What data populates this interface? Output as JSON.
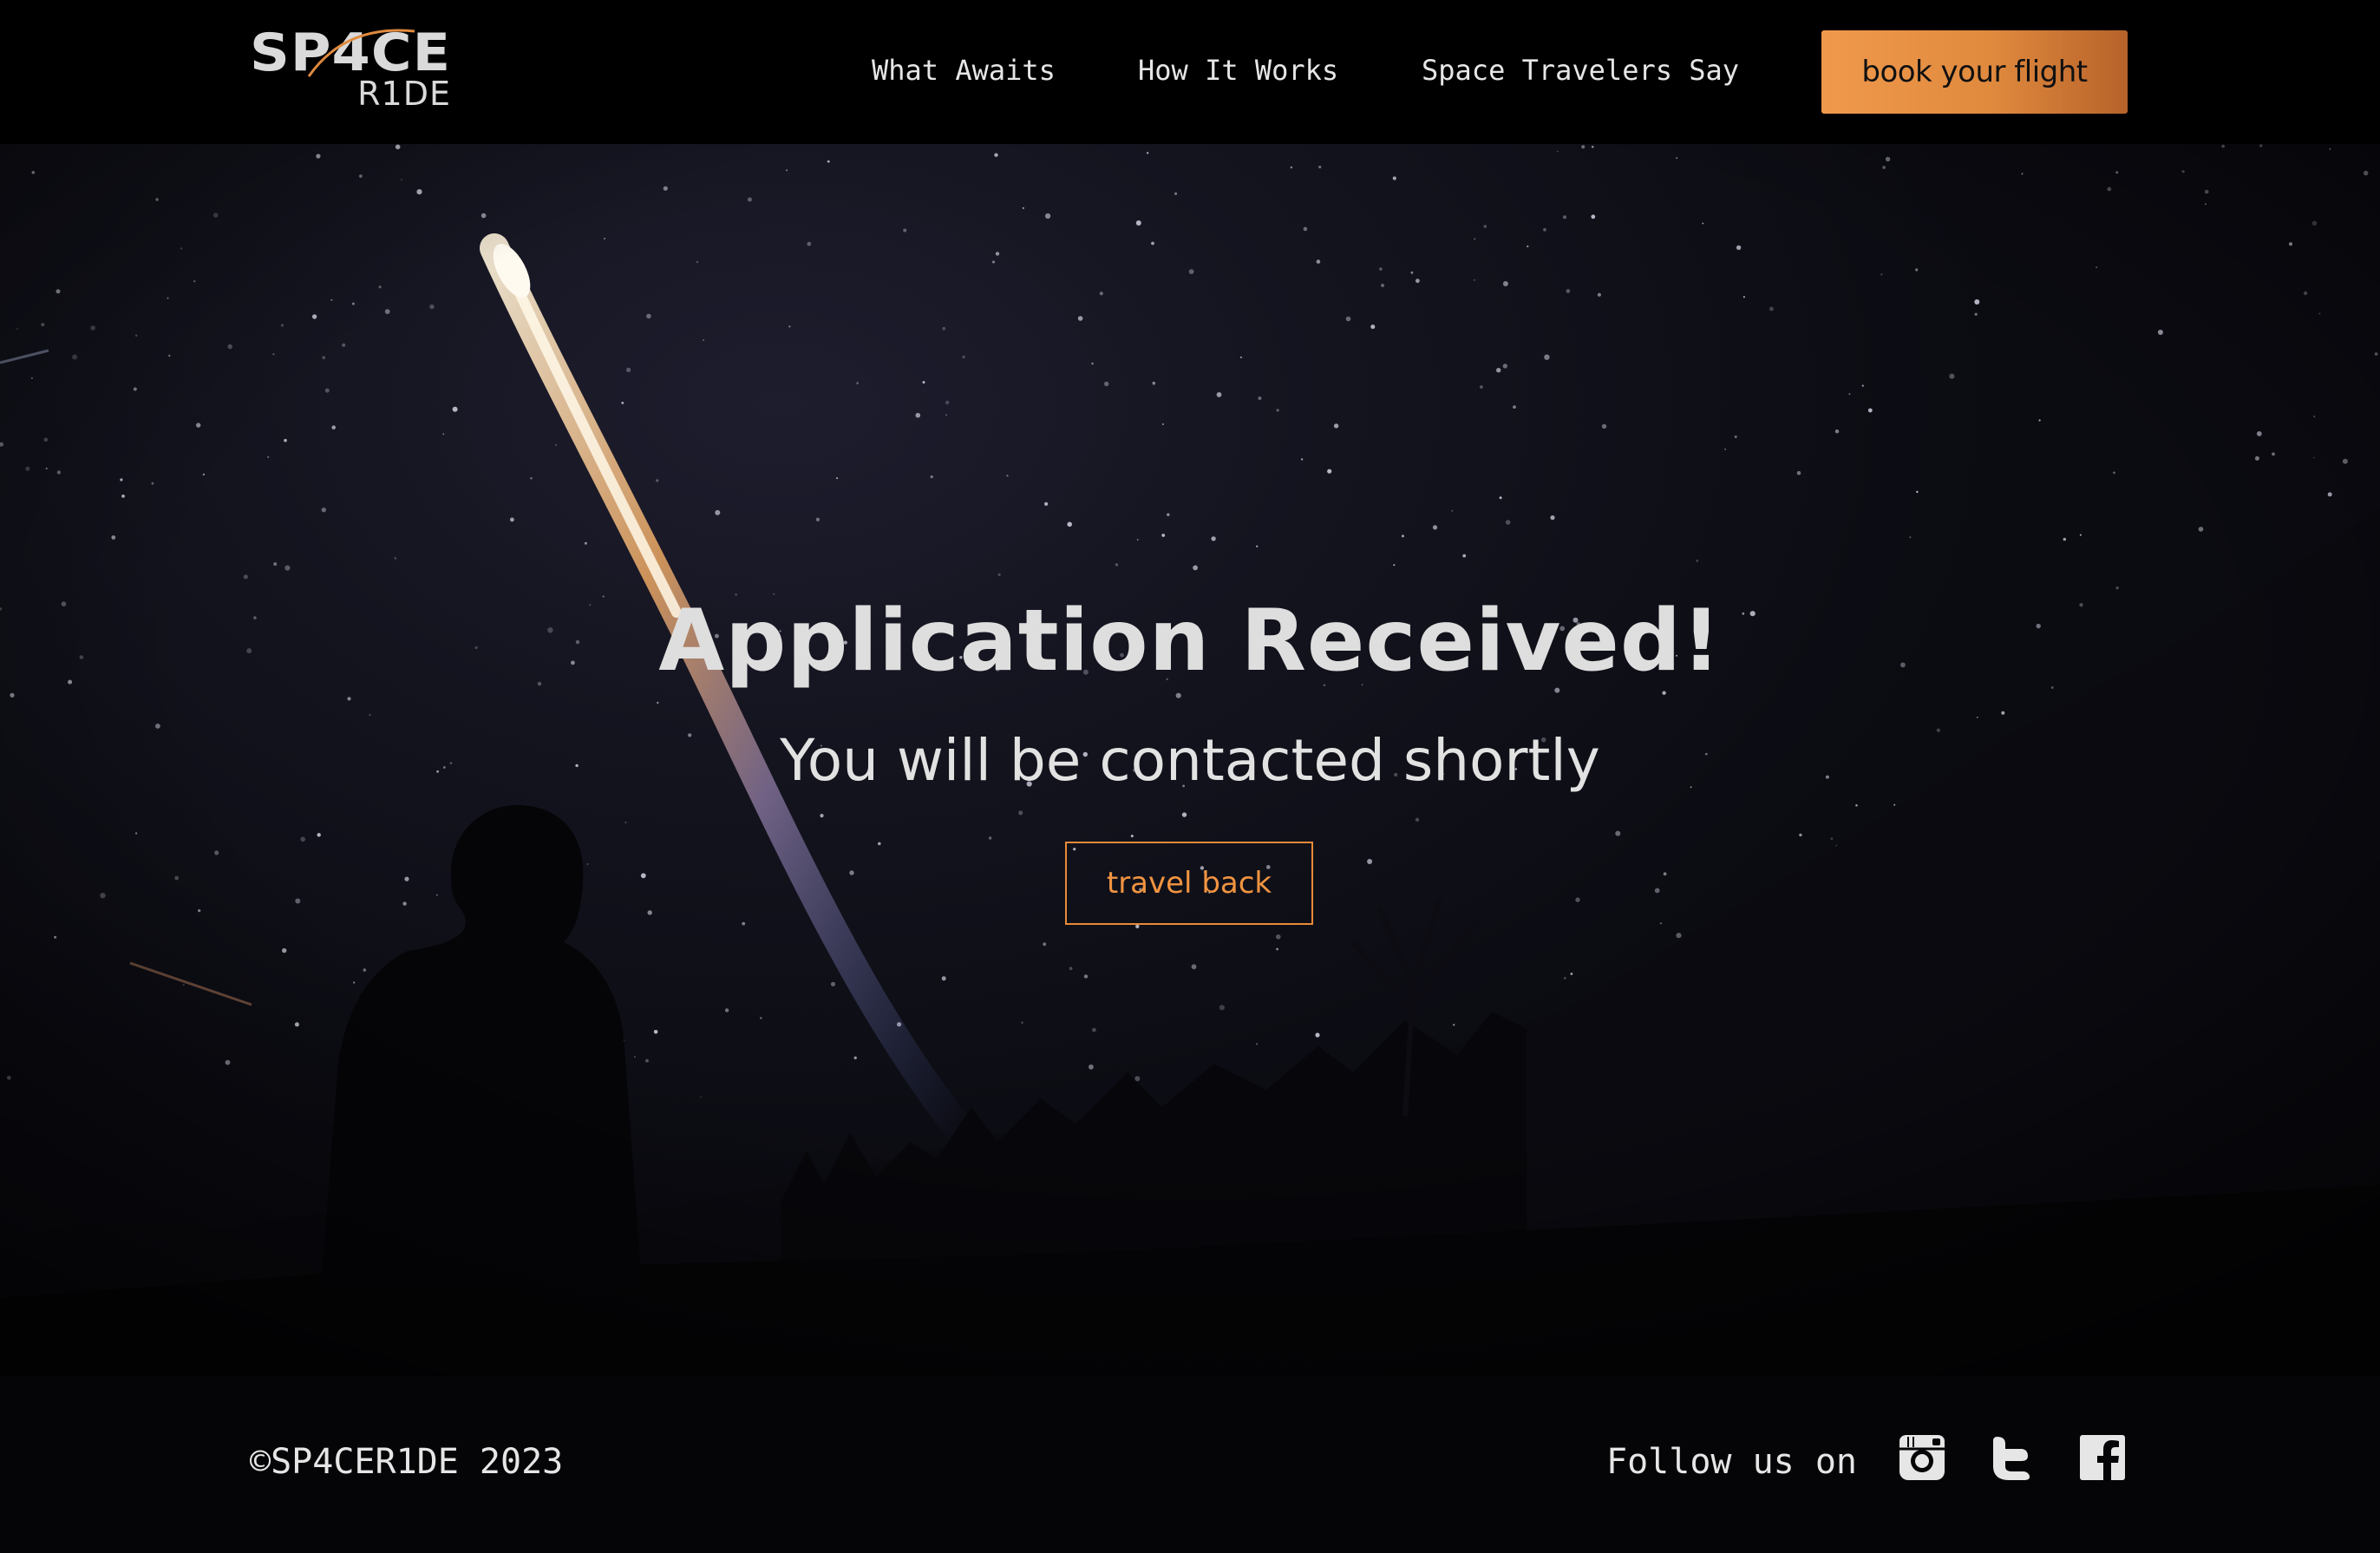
{
  "header": {
    "logo": {
      "line1": "SP4CE",
      "line2": "R1DE"
    },
    "nav": [
      {
        "label": "What Awaits"
      },
      {
        "label": "How It Works"
      },
      {
        "label": "Space Travelers Say"
      }
    ],
    "cta_label": "book your flight"
  },
  "hero": {
    "title": "Application Received!",
    "subtitle": "You will be contacted shortly",
    "button_label": "travel back"
  },
  "footer": {
    "copyright": "©SP4CER1DE 2023",
    "follow_label": "Follow us on",
    "social": [
      {
        "icon": "instagram-icon"
      },
      {
        "icon": "twitter-icon"
      },
      {
        "icon": "facebook-icon"
      }
    ]
  },
  "colors": {
    "accent": "#f0994d",
    "accent_dark": "#b7622a",
    "background": "#000000",
    "text": "#e0e0e0"
  }
}
